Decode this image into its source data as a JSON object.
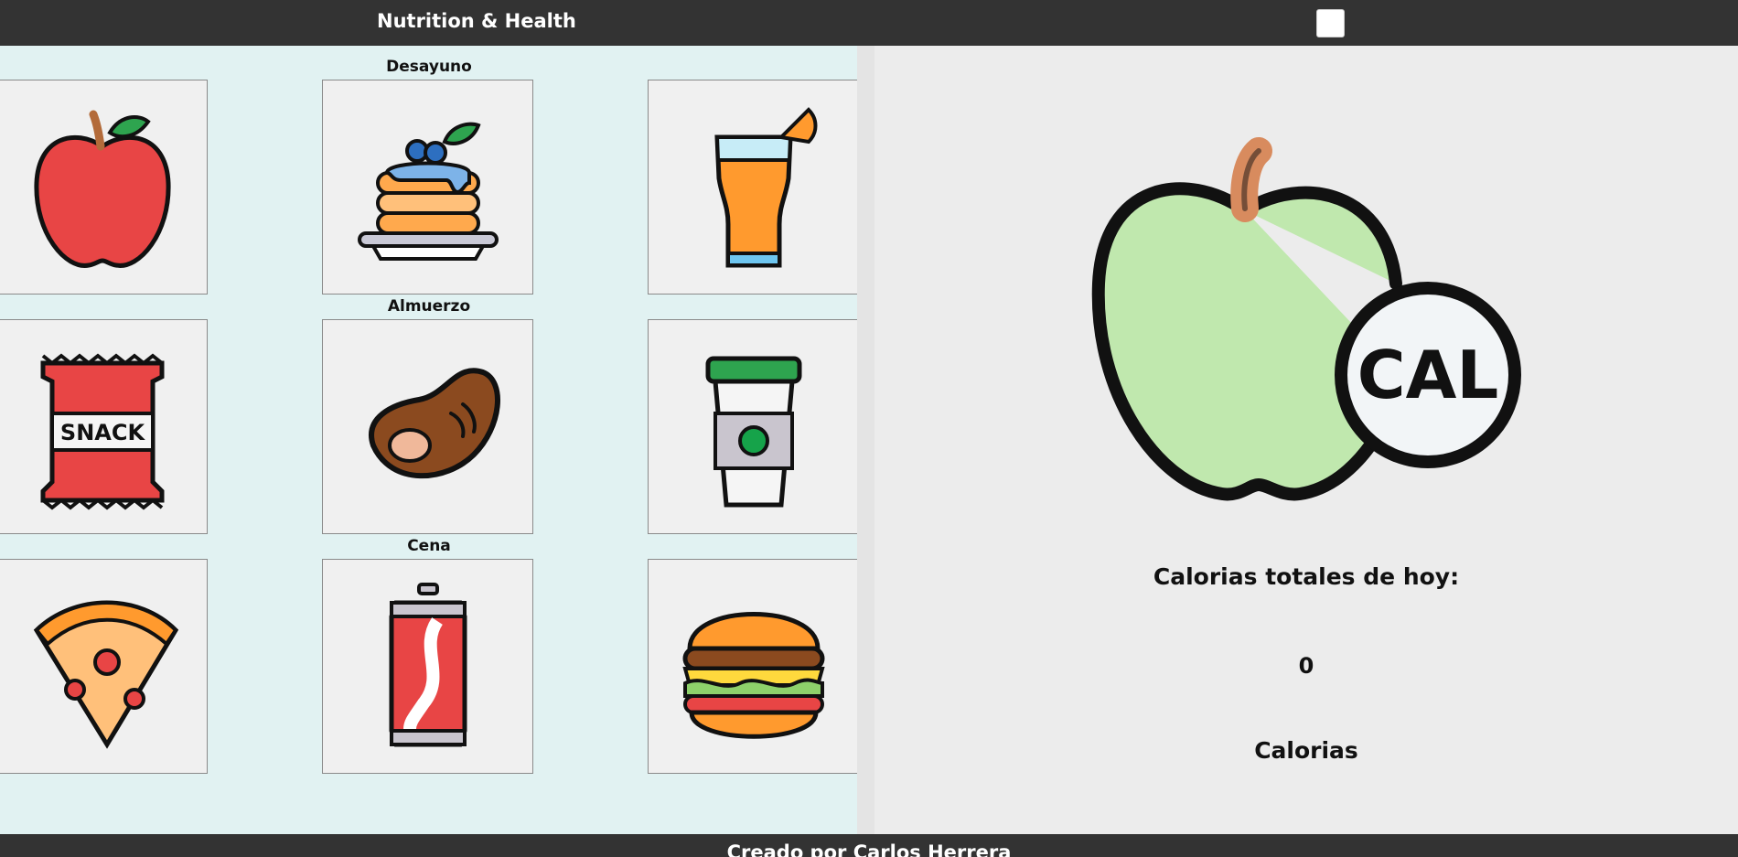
{
  "header": {
    "title": "Nutrition & Health"
  },
  "sections": {
    "breakfast": "Desayuno",
    "lunch": "Almuerzo",
    "dinner": "Cena"
  },
  "foods": {
    "apple": {
      "icon": "apple-icon"
    },
    "pancakes": {
      "icon": "pancakes-icon"
    },
    "juice": {
      "icon": "orange-juice-icon"
    },
    "snack": {
      "icon": "snack-bag-icon",
      "label": "SNACK"
    },
    "steak": {
      "icon": "steak-icon"
    },
    "coffee": {
      "icon": "coffee-cup-icon"
    },
    "pizza": {
      "icon": "pizza-slice-icon"
    },
    "soda": {
      "icon": "soda-can-icon"
    },
    "burger": {
      "icon": "burger-icon"
    }
  },
  "calories": {
    "logo_text": "CAL",
    "heading": "Calorias totales de hoy:",
    "value": "0",
    "unit": "Calorias"
  },
  "footer": {
    "text": "Creado por Carlos Herrera"
  },
  "colors": {
    "header_bg": "#333333",
    "left_panel_bg": "#e1f2f2",
    "right_panel_bg": "#ececec",
    "card_bg": "#f0f0f0"
  }
}
